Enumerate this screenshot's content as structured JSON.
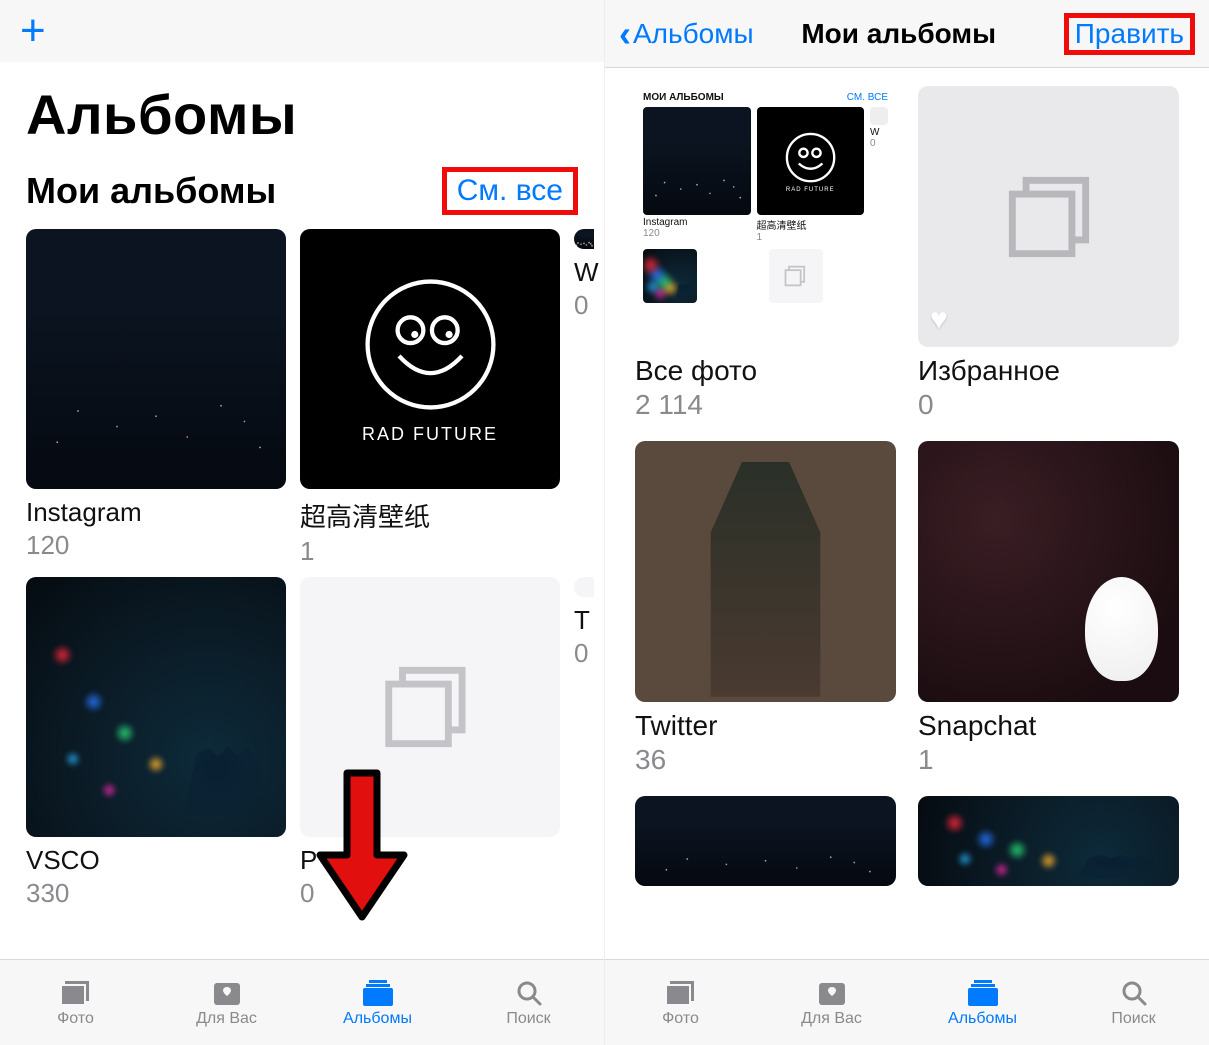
{
  "colors": {
    "accent": "#007aff",
    "highlight": "#f10c0c",
    "muted": "#8a8a8e"
  },
  "screen1": {
    "page_title": "Альбомы",
    "section_title": "Мои альбомы",
    "see_all_label": "См. все",
    "albums": [
      {
        "title": "Instagram",
        "count": "120",
        "visual": "night-city"
      },
      {
        "title": "超高清壁纸",
        "count": "1",
        "visual": "radfuture",
        "caption": "RAD FUTURE"
      },
      {
        "title": "W",
        "count": "0",
        "visual": "partial"
      },
      {
        "title": "VSCO",
        "count": "330",
        "visual": "bokeh-hand"
      },
      {
        "title": "P",
        "count": "0",
        "visual": "placeholder"
      },
      {
        "title": "T",
        "count": "0",
        "visual": "partial"
      }
    ]
  },
  "screen2": {
    "back_label": "Альбомы",
    "nav_title": "Мои альбомы",
    "edit_label": "Править",
    "all_photos_preview": {
      "header_left": "МОИ АЛЬБОМЫ",
      "header_right": "СМ. ВСЕ",
      "items": [
        {
          "title": "Instagram",
          "count": "120"
        },
        {
          "title": "超高清壁纸",
          "count": "1"
        },
        {
          "title": "W",
          "count": "0"
        }
      ]
    },
    "albums": [
      {
        "title": "Все фото",
        "count": "2 114",
        "visual": "allphotos"
      },
      {
        "title": "Избранное",
        "count": "0",
        "visual": "favorites"
      },
      {
        "title": "Twitter",
        "count": "36",
        "visual": "twitter"
      },
      {
        "title": "Snapchat",
        "count": "1",
        "visual": "snapchat"
      },
      {
        "title": "",
        "count": "",
        "visual": "night-city"
      },
      {
        "title": "",
        "count": "",
        "visual": "bokeh-hand"
      }
    ]
  },
  "tabbar": {
    "items": [
      {
        "label": "Фото",
        "icon": "photos-icon"
      },
      {
        "label": "Для Вас",
        "icon": "foryou-icon"
      },
      {
        "label": "Альбомы",
        "icon": "albums-icon",
        "active": true
      },
      {
        "label": "Поиск",
        "icon": "search-icon"
      }
    ]
  }
}
